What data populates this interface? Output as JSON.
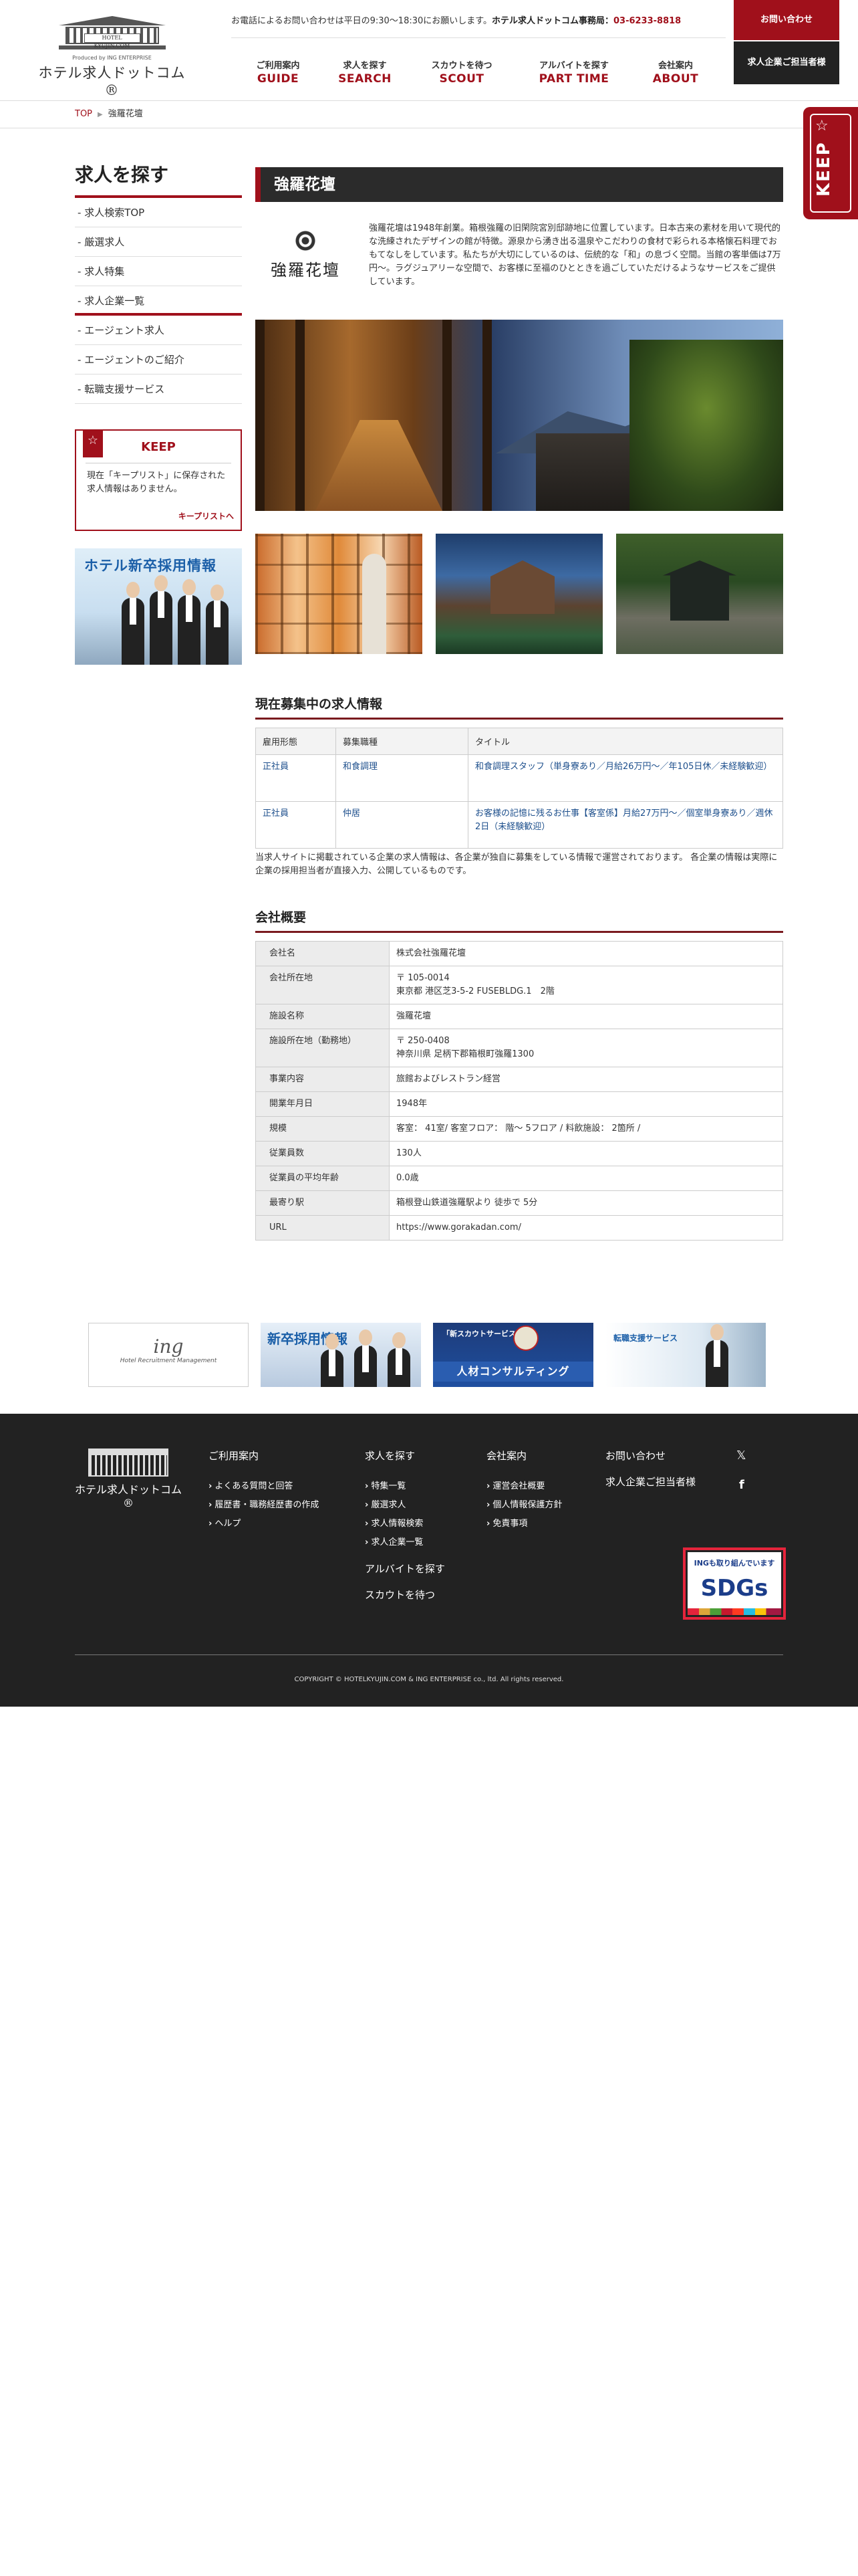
{
  "header": {
    "logo_plate": "HOTEL KYUJIN.COM",
    "logo_produced": "Produced by ING ENTERPRISE",
    "logo_jp": "ホテル求人ドットコム®",
    "contact_text": "お電話によるお問い合わせは平日の9:30〜18:30にお願いします。",
    "office_label": "ホテル求人ドットコム事務局：",
    "office_tel": "03-6233-8818",
    "nav": [
      {
        "jp": "ご利用案内",
        "en": "GUIDE"
      },
      {
        "jp": "求人を探す",
        "en": "SEARCH"
      },
      {
        "jp": "スカウトを待つ",
        "en": "SCOUT"
      },
      {
        "jp": "アルバイトを探す",
        "en": "PART TIME"
      },
      {
        "jp": "会社案内",
        "en": "ABOUT"
      }
    ],
    "contact_button": "お問い合わせ",
    "company_button": "求人企業ご担当者様"
  },
  "breadcrumb": {
    "top": "TOP",
    "current": "強羅花壇"
  },
  "keep_side": {
    "label": "KEEP"
  },
  "sidebar": {
    "title": "求人を探す",
    "group1": [
      "求人検索TOP",
      "厳選求人",
      "求人特集",
      "求人企業一覧"
    ],
    "group2": [
      "エージェント求人",
      "エージェントのご紹介",
      "転職支援サービス"
    ],
    "keep_title": "KEEP",
    "keep_message": "現在「キープリスト」に保存された求人情報はありません。",
    "keep_link": "キープリストへ",
    "banner_title": "ホテル新卒採用情報"
  },
  "main": {
    "title": "強羅花壇",
    "logo_name": "強羅花壇",
    "description": "強羅花壇は1948年創業。箱根強羅の旧閑院宮別邸跡地に位置しています。日本古来の素材を用いて現代的な洗練されたデザインの館が特徴。源泉から湧き出る温泉やこだわりの食材で彩られる本格懐石料理でおもてなしをしています。私たちが大切にしているのは、伝統的な「和」の息づく空間。当館の客単価は7万円〜。ラグジュアリーな空間で、お客様に至福のひとときを過ごしていただけるようなサービスをご提供しています。"
  },
  "jobs": {
    "heading": "現在募集中の求人情報",
    "headers": [
      "雇用形態",
      "募集職種",
      "タイトル"
    ],
    "rows": [
      {
        "type": "正社員",
        "role": "和食調理",
        "title": "和食調理スタッフ（単身寮あり／月給26万円〜／年105日休／未経験歓迎）"
      },
      {
        "type": "正社員",
        "role": "仲居",
        "title": "お客様の記憶に残るお仕事【客室係】月給27万円〜／個室単身寮あり／週休2日（未経験歓迎）"
      }
    ],
    "note": "当求人サイトに掲載されている企業の求人情報は、各企業が独自に募集をしている情報で運営されております。 各企業の情報は実際に企業の採用担当者が直接入力、公開しているものです。"
  },
  "company": {
    "heading": "会社概要",
    "rows": [
      {
        "label": "会社名",
        "value": [
          "株式会社強羅花壇"
        ]
      },
      {
        "label": "会社所在地",
        "value": [
          "〒 105-0014",
          "東京都 港区芝3-5-2 FUSEBLDG.1　2階"
        ]
      },
      {
        "label": "施設名称",
        "value": [
          "強羅花壇"
        ]
      },
      {
        "label": "施設所在地（勤務地）",
        "value": [
          "〒 250-0408",
          "神奈川県 足柄下郡箱根町強羅1300"
        ]
      },
      {
        "label": "事業内容",
        "value": [
          "旅館およびレストラン経営"
        ]
      },
      {
        "label": "開業年月日",
        "value": [
          "1948年"
        ]
      },
      {
        "label": "規模",
        "value": [
          "客室： 41室/ 客室フロア： 階〜 5フロア / 料飲施設： 2箇所 /"
        ]
      },
      {
        "label": "従業員数",
        "value": [
          "130人"
        ]
      },
      {
        "label": "従業員の平均年齢",
        "value": [
          "0.0歳"
        ]
      },
      {
        "label": "最寄り駅",
        "value": [
          "箱根登山鉄道強羅駅より 徒歩で 5分"
        ]
      },
      {
        "label": "URL",
        "value": [
          "https://www.gorakadan.com/"
        ]
      }
    ]
  },
  "banners": {
    "ing": "ing",
    "ing_sub": "Hotel Recruitment Management",
    "shinsotsu": "新卒採用情報",
    "scout_small": "「新スカウトサービス」",
    "scout_big": "人材コンサルティング",
    "support": "転職支援サービス"
  },
  "footer": {
    "logo_jp": "ホテル求人ドットコム®",
    "cols": [
      {
        "title": "ご利用案内",
        "items": [
          "よくある質問と回答",
          "履歴書・職務経歴書の作成",
          "ヘルプ"
        ]
      },
      {
        "title": "求人を探す",
        "items": [
          "特集一覧",
          "厳選求人",
          "求人情報検索",
          "求人企業一覧"
        ],
        "extra": [
          "アルバイトを探す",
          "スカウトを待つ"
        ]
      },
      {
        "title": "会社案内",
        "items": [
          "運営会社概要",
          "個人情報保護方針",
          "免責事項"
        ]
      },
      {
        "title": "お問い合わせ",
        "items": [],
        "extra": [
          "求人企業ご担当者様"
        ]
      }
    ],
    "sdgs_top": "INGも取り組んでいます",
    "sdgs_main": "SDGs",
    "copyright": "COPYRIGHT © HOTELKYUJIN.COM & ING ENTERPRISE co., ltd. All rights reserved."
  }
}
